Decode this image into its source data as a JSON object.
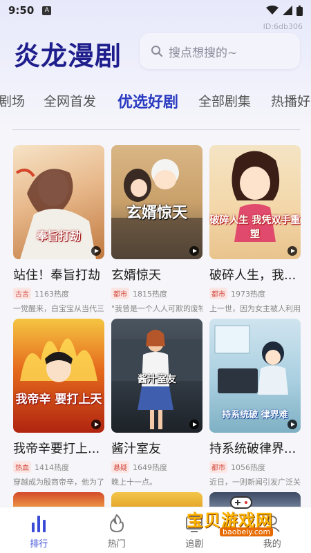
{
  "status_bar": {
    "time": "9:50",
    "app_icon": "A"
  },
  "device_id": "ID:6db306",
  "app_title": "炎龙漫剧",
  "search": {
    "placeholder": "搜点想搜的~"
  },
  "tabs": [
    {
      "label": "剧场",
      "active": false
    },
    {
      "label": "全网首发",
      "active": false
    },
    {
      "label": "优选好剧",
      "active": true
    },
    {
      "label": "全部剧集",
      "active": false
    },
    {
      "label": "热播好",
      "active": false
    }
  ],
  "cards": [
    {
      "title": "站住！奉旨打劫",
      "tag": "古言",
      "heat": "1163热度",
      "desc": "一觉醒来，白宝宝从当代三...",
      "cover_text": "奉旨打劫"
    },
    {
      "title": "玄婿惊天",
      "tag": "都市",
      "heat": "1815热度",
      "desc": "\"我曾是一个人人可欺的废物...",
      "cover_text": "玄婿惊天"
    },
    {
      "title": "破碎人生，我...",
      "tag": "都市",
      "heat": "1973热度",
      "desc": "上一世，因为女主被人利用...",
      "cover_text": "破碎人生 我凭双手重塑"
    },
    {
      "title": "我帝辛要打上...",
      "tag": "热血",
      "heat": "1414热度",
      "desc": "穿越成为殷商帝辛，他为了...",
      "cover_text": "我帝辛 要打上天"
    },
    {
      "title": "酱汁室友",
      "tag": "悬疑",
      "heat": "1649热度",
      "desc": "晚上十一点。",
      "cover_text": "酱汁室友"
    },
    {
      "title": "持系统破律界...",
      "tag": "都市",
      "heat": "1056热度",
      "desc": "近日，一则新闻引发广泛关...",
      "cover_text": "持系统破 律界难"
    }
  ],
  "bottom_nav": [
    {
      "label": "排行",
      "icon": "bar-chart-icon",
      "active": true
    },
    {
      "label": "热门",
      "icon": "flame-icon",
      "active": false
    },
    {
      "label": "追剧",
      "icon": "tv-icon",
      "active": false
    },
    {
      "label": "我的",
      "icon": "profile-icon",
      "active": false
    }
  ],
  "watermark": {
    "text": "宝贝游戏网",
    "url": "baobeiy.com"
  },
  "colors": {
    "accent": "#2a3ac0",
    "title": "#1e1e8c",
    "badge": "#d0463a"
  }
}
